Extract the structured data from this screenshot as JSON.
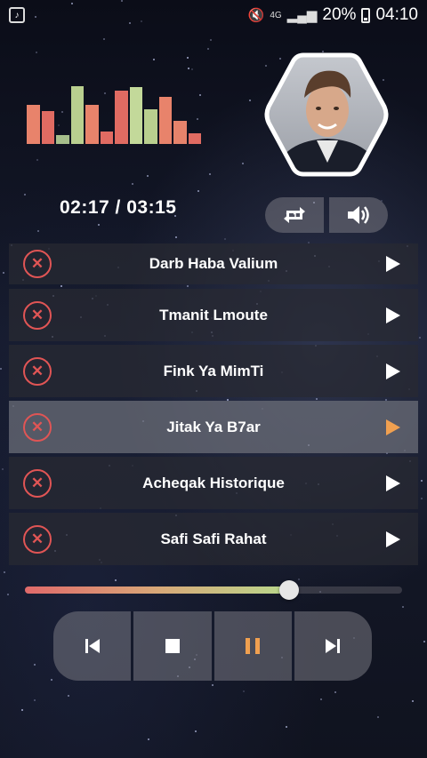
{
  "status_bar": {
    "signal_label": "4G",
    "battery": "20%",
    "time": "04:10"
  },
  "equalizer": {
    "levels": [
      0.65,
      0.55,
      0.14,
      0.96,
      0.64,
      0.21,
      0.88,
      0.94,
      0.58,
      0.78,
      0.38,
      0.18
    ],
    "colors": [
      "#e8836b",
      "#e06b62",
      "#a6be8b",
      "#b9cf8f",
      "#e8836b",
      "#e06b62",
      "#e06b62",
      "#c3d99a",
      "#b9cf8f",
      "#e8836b",
      "#e6836b",
      "#e06b62"
    ]
  },
  "player": {
    "time_display": "02:17 / 03:15",
    "progress": 0.7,
    "repeat_icon": "repeat-one-icon",
    "volume_icon": "volume-icon"
  },
  "playlist": [
    {
      "title": "Darb Haba Valium",
      "active": false
    },
    {
      "title": "Tmanit Lmoute",
      "active": false
    },
    {
      "title": "Fink Ya MimTi",
      "active": false
    },
    {
      "title": "Jitak Ya B7ar",
      "active": true
    },
    {
      "title": "Acheqak Historique",
      "active": false
    },
    {
      "title": "Safi Safi Rahat",
      "active": false
    }
  ],
  "transport": {
    "previous_icon": "skip-previous-icon",
    "stop_icon": "stop-icon",
    "pause_icon": "pause-icon",
    "next_icon": "skip-next-icon",
    "accent": "#f0a050"
  }
}
